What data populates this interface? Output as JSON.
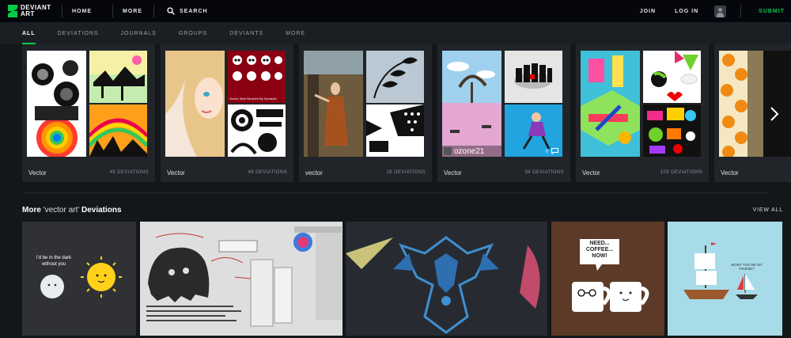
{
  "topnav": {
    "logo_line1": "DEVIANT",
    "logo_line2": "ART",
    "home": "HOME",
    "more": "MORE",
    "search": "SEARCH",
    "join": "JOIN",
    "login": "LOG IN",
    "submit": "SUBMIT"
  },
  "tabs": [
    "ALL",
    "DEVIATIONS",
    "JOURNALS",
    "GROUPS",
    "DEVIANTS",
    "MORE"
  ],
  "galleries": [
    {
      "label": "Vector",
      "count": "49 DEVIATIONS"
    },
    {
      "label": "Vector",
      "count": "49 DEVIATIONS"
    },
    {
      "label": "vector",
      "count": "28 DEVIATIONS"
    },
    {
      "label": "Vector",
      "count": "54 DEVIATIONS"
    },
    {
      "label": "Vector",
      "count": "109 DEVIATIONS"
    },
    {
      "label": "Vector",
      "count": ""
    }
  ],
  "thumb_texts": {
    "skull_caption": "Vector Skull Brushes By Symbolic",
    "username": "ozone21",
    "comment_count": "0"
  },
  "more_section": {
    "prefix": "More",
    "query": "'vector art'",
    "suffix": "Deviations",
    "view_all": "VIEW ALL"
  },
  "deviation_texts": {
    "moon_text": "I'd be in the dark without you",
    "coffee_text": "NEED... COFFEE... NOW!",
    "boat_text": "WONT YOU BE MY FRIEND?"
  },
  "colors": {
    "accent": "#05cc47",
    "background": "#14171a",
    "nav": "#06070d"
  }
}
